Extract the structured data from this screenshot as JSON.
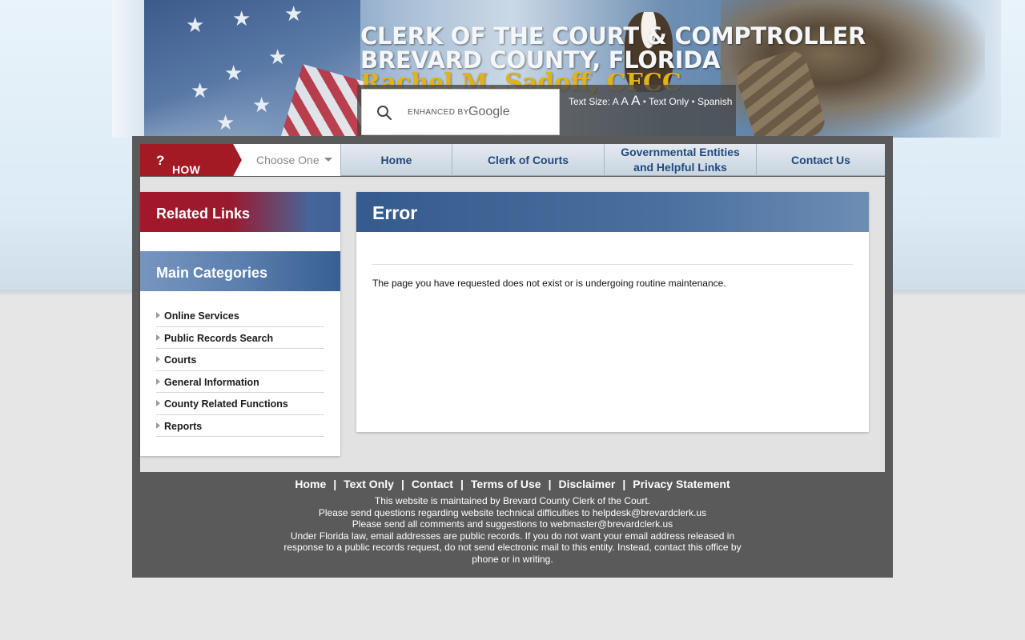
{
  "header": {
    "title_line1": "CLERK OF THE COURT & COMPTROLLER",
    "title_line2": "BREVARD COUNTY, FLORIDA",
    "subtitle": "Rachel M. Sadoff, CFCC",
    "search": {
      "enhanced_label": "ENHANCED BY",
      "provider": "Google"
    },
    "text_size": {
      "label": "Text Size:",
      "sizes": [
        "A",
        "A",
        "A"
      ],
      "text_only": "Text Only",
      "spanish": "Spanish",
      "separator": "•"
    }
  },
  "nav": {
    "how_do_i": "HOW DO I",
    "how_do_i_mark": "?",
    "choose_one": "Choose One",
    "items": [
      {
        "label": "Home"
      },
      {
        "label": "Clerk of Courts"
      },
      {
        "label": "Governmental Entities and Helpful Links"
      },
      {
        "label": "Contact Us"
      }
    ]
  },
  "sidebar": {
    "related_links_title": "Related Links",
    "main_categories_title": "Main Categories",
    "categories": [
      {
        "label": "Online Services"
      },
      {
        "label": "Public Records Search"
      },
      {
        "label": "Courts"
      },
      {
        "label": "General Information"
      },
      {
        "label": "County Related Functions"
      },
      {
        "label": "Reports"
      }
    ]
  },
  "main": {
    "title": "Error",
    "message": "The page you have requested does not exist or is undergoing routine maintenance."
  },
  "footer": {
    "links": [
      {
        "label": "Home"
      },
      {
        "label": "Text Only"
      },
      {
        "label": "Contact"
      },
      {
        "label": "Terms of Use"
      },
      {
        "label": "Disclaimer"
      },
      {
        "label": "Privacy Statement"
      }
    ],
    "separator": "|",
    "lines": [
      "This website is maintained by Brevard County Clerk of the Court.",
      "Please send questions regarding website technical difficulties to helpdesk@brevardclerk.us",
      "Please send all comments and suggestions to webmaster@brevardclerk.us",
      "Under Florida law, email addresses are public records. If you do not want your email address released in response to a public records request, do not send electronic mail to this entity. Instead, contact this office by phone or in writing."
    ]
  },
  "colors": {
    "brand_red": "#a21a24",
    "brand_blue": "#345b8c",
    "nav_text": "#1f4a7e",
    "subtitle_gold": "#e2b21c"
  }
}
